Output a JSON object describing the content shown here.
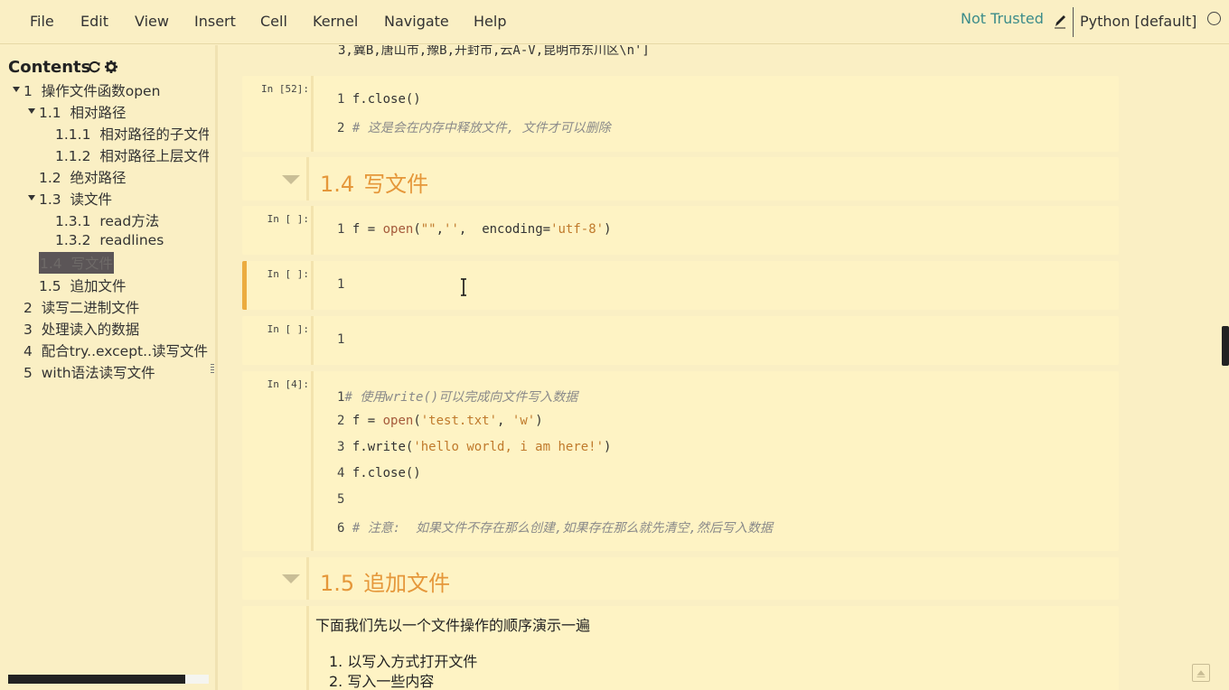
{
  "menubar": {
    "items": [
      "File",
      "Edit",
      "View",
      "Insert",
      "Cell",
      "Kernel",
      "Navigate",
      "Help"
    ],
    "trusted_label": "Not Trusted",
    "kernel_name": "Python [default]"
  },
  "toc": {
    "title": "Contents",
    "items": [
      {
        "num": "1",
        "label": "操作文件函数open"
      },
      {
        "num": "1.1",
        "label": "相对路径"
      },
      {
        "num": "1.1.1",
        "label": "相对路径的子文件"
      },
      {
        "num": "1.1.2",
        "label": "相对路径上层文件"
      },
      {
        "num": "1.2",
        "label": "绝对路径"
      },
      {
        "num": "1.3",
        "label": "读文件"
      },
      {
        "num": "1.3.1",
        "label": "read方法"
      },
      {
        "num": "1.3.2",
        "label": "readlines"
      },
      {
        "num": "1.4",
        "label": "写文件"
      },
      {
        "num": "1.5",
        "label": "追加文件"
      },
      {
        "num": "2",
        "label": "读写二进制文件"
      },
      {
        "num": "3",
        "label": "处理读入的数据"
      },
      {
        "num": "4",
        "label": "配合try..except..读写文件"
      },
      {
        "num": "5",
        "label": "with语法读写文件"
      }
    ]
  },
  "notebook": {
    "partial_output": "3,冀B,唐山市,豫B,开封市,云A-V,昆明市东川区\\n']",
    "cells": [
      {
        "prompt": "In [52]:",
        "lines": [
          "f.close()",
          "# 这是会在内存中释放文件, 文件才可以删除"
        ]
      },
      {
        "heading_num": "1.4",
        "heading_text": "写文件"
      },
      {
        "prompt": "In [ ]:",
        "line": "f = open(\"\",'',  encoding='utf-8')"
      },
      {
        "prompt": "In [ ]:",
        "line": ""
      },
      {
        "prompt": "In [ ]:",
        "line": ""
      },
      {
        "prompt": "In [4]:",
        "lines": [
          "# 使用write()可以完成向文件写入数据",
          "f = open('test.txt', 'w')",
          "f.write('hello world, i am here!')",
          "f.close()",
          "",
          "# 注意:  如果文件不存在那么创建,如果存在那么就先清空,然后写入数据"
        ]
      },
      {
        "heading_num": "1.5",
        "heading_text": "追加文件"
      },
      {
        "md_intro": "下面我们先以一个文件操作的顺序演示一遍",
        "md_list": [
          "1. 以写入方式打开文件",
          "2. 写入一些内容"
        ]
      }
    ]
  },
  "line_numbers": [
    "1",
    "2",
    "3",
    "4",
    "5",
    "6"
  ]
}
